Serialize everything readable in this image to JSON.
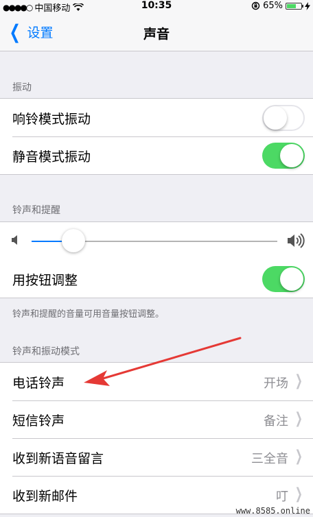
{
  "status": {
    "signal_dots": "●●●●○",
    "carrier": "中国移动",
    "time": "10:35",
    "battery": "65%",
    "battery_level": 0.65
  },
  "nav": {
    "back_label": "设置",
    "title": "声音"
  },
  "vibrate": {
    "header": "振动",
    "rows": [
      {
        "label": "响铃模式振动",
        "on": false
      },
      {
        "label": "静音模式振动",
        "on": true
      }
    ]
  },
  "ringer": {
    "header": "铃声和提醒",
    "volume_level": 0.17,
    "button_adjust_label": "用按钮调整",
    "button_adjust_on": true,
    "footer": "铃声和提醒的音量可用音量按钮调整。"
  },
  "sounds": {
    "header": "铃声和振动模式",
    "rows": [
      {
        "label": "电话铃声",
        "value": "开场"
      },
      {
        "label": "短信铃声",
        "value": "备注"
      },
      {
        "label": "收到新语音留言",
        "value": "三全音"
      },
      {
        "label": "收到新邮件",
        "value": "叮"
      }
    ]
  },
  "watermark": "www.8585.online",
  "colors": {
    "accent": "#007aff",
    "toggle_on": "#4cd964",
    "arrow": "#e53935"
  }
}
